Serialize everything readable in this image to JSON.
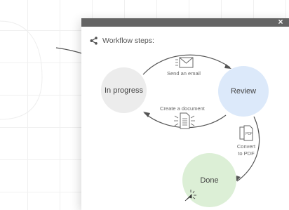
{
  "window": {
    "close_label": "×"
  },
  "header": {
    "title": "Workflow steps:",
    "icon": "workflow-icon"
  },
  "nodes": {
    "in_progress": "In progress",
    "review": "Review",
    "done": "Done"
  },
  "edges": {
    "send_email": "Send an email",
    "create_document": "Create a document",
    "convert_pdf": "Convert to PDF"
  },
  "icons": {
    "email": "envelope-icon",
    "document": "document-icon",
    "pdf": "pdf-icon",
    "cursor": "cursor-click-icon"
  },
  "colors": {
    "titlebar": "#646464",
    "in_progress_bg": "#ececec",
    "review_bg": "#dce9fa",
    "done_bg": "#dcefd6",
    "arrow": "#555555"
  }
}
